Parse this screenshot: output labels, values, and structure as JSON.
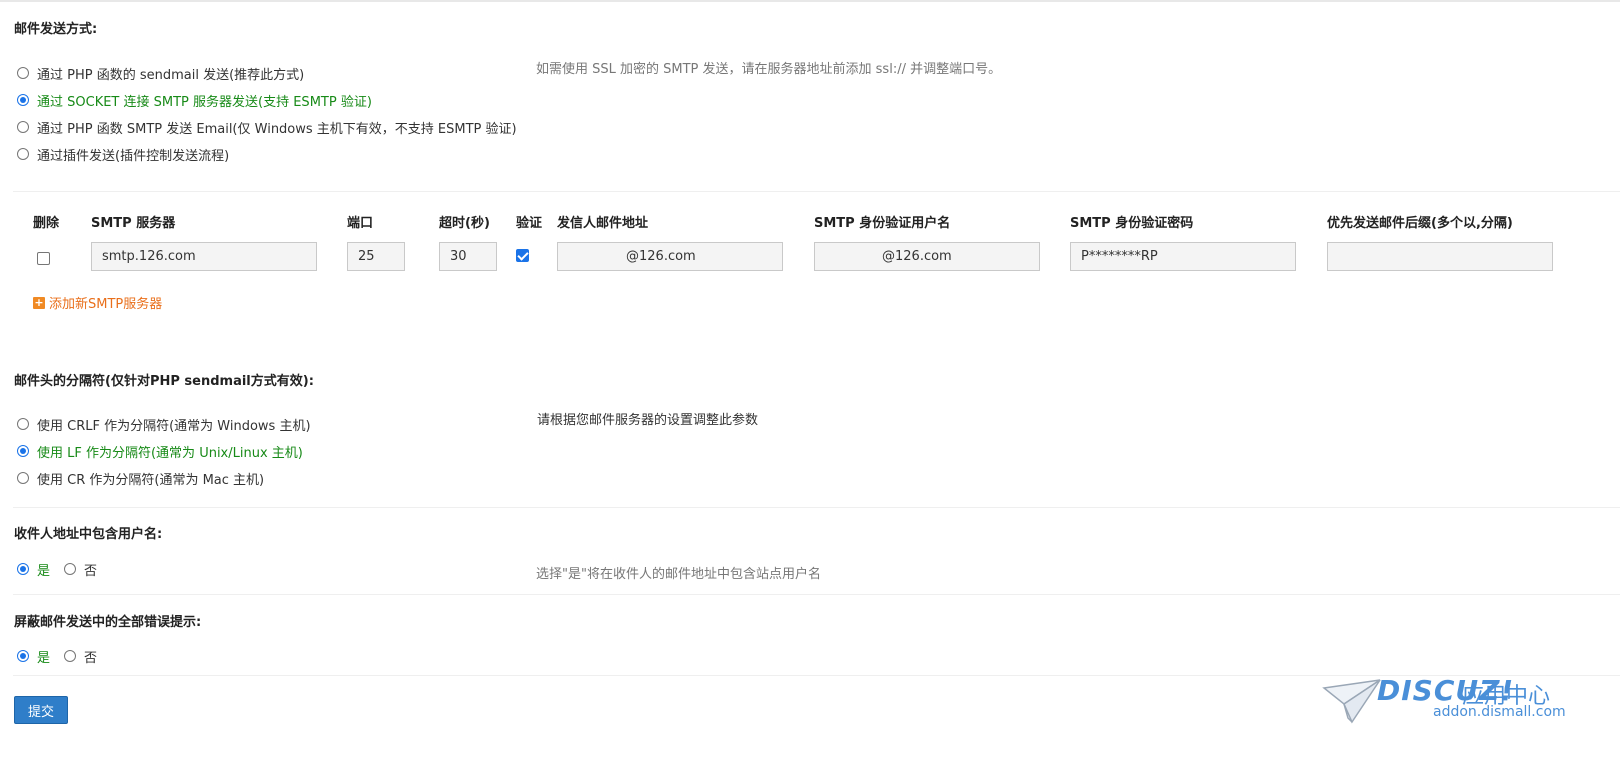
{
  "send_method": {
    "title": "邮件发送方式:",
    "tip": "如需使用 SSL 加密的 SMTP 发送，请在服务器地址前添加 ssl:// 并调整端口号。",
    "options": [
      {
        "label": "通过 PHP 函数的 sendmail 发送(推荐此方式)",
        "checked": false
      },
      {
        "label": "通过 SOCKET 连接 SMTP 服务器发送(支持 ESMTP 验证)",
        "checked": true
      },
      {
        "label": "通过 PHP 函数 SMTP 发送 Email(仅 Windows 主机下有效，不支持 ESMTP 验证)",
        "checked": false
      },
      {
        "label": "通过插件发送(插件控制发送流程)",
        "checked": false
      }
    ]
  },
  "smtp_table": {
    "headers": {
      "delete": "删除",
      "server": "SMTP 服务器",
      "port": "端口",
      "timeout": "超时(秒)",
      "auth": "验证",
      "from": "发信人邮件地址",
      "auth_user": "SMTP 身份验证用户名",
      "auth_pass": "SMTP 身份验证密码",
      "suffix": "优先发送邮件后缀(多个以,分隔)"
    },
    "row": {
      "delete_checked": false,
      "server": "smtp.126.com",
      "port": "25",
      "timeout": "30",
      "auth_checked": true,
      "from": "@126.com",
      "auth_user": "@126.com",
      "auth_pass": "P********RP",
      "suffix": ""
    },
    "add_label": "添加新SMTP服务器"
  },
  "header_separator": {
    "title": "邮件头的分隔符(仅针对PHP sendmail方式有效):",
    "tip": "请根据您邮件服务器的设置调整此参数",
    "options": [
      {
        "label": "使用 CRLF 作为分隔符(通常为 Windows 主机)",
        "checked": false
      },
      {
        "label": "使用 LF 作为分隔符(通常为 Unix/Linux 主机)",
        "checked": true
      },
      {
        "label": "使用 CR 作为分隔符(通常为 Mac 主机)",
        "checked": false
      }
    ]
  },
  "include_username": {
    "title": "收件人地址中包含用户名:",
    "tip": "选择\"是\"将在收件人的邮件地址中包含站点用户名",
    "yes": "是",
    "no": "否"
  },
  "silent_errors": {
    "title": "屏蔽邮件发送中的全部错误提示:",
    "yes": "是",
    "no": "否"
  },
  "submit_label": "提交",
  "watermark": {
    "brand": "DISCUZ!",
    "brand_cn": "应用中心",
    "site": "addon.dismall.com"
  },
  "colors": {
    "active_option": "#178a17",
    "accent": "#1a73e8",
    "submit_bg": "#2f7ec9",
    "link": "#e96f1b"
  }
}
